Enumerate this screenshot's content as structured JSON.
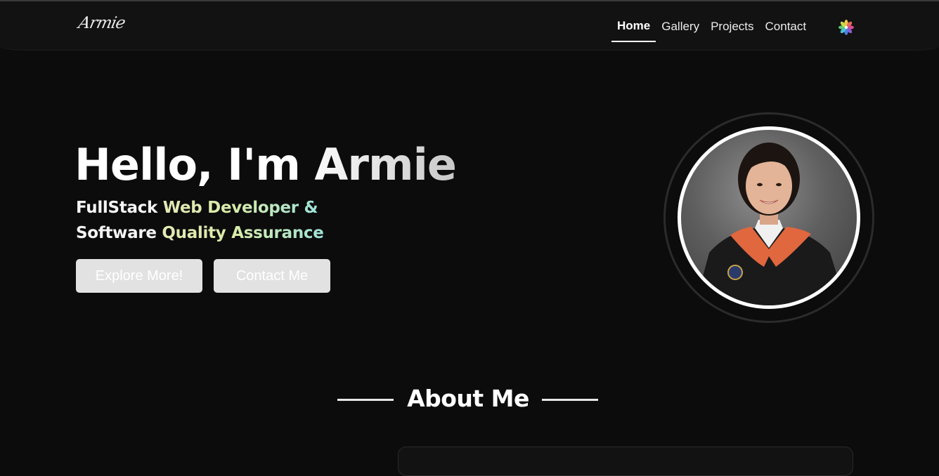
{
  "header": {
    "logo_text": "Armie",
    "nav": [
      {
        "label": "Home",
        "active": true
      },
      {
        "label": "Gallery",
        "active": false
      },
      {
        "label": "Projects",
        "active": false
      },
      {
        "label": "Contact",
        "active": false
      }
    ],
    "theme_icon": "flower-icon"
  },
  "hero": {
    "title": "Hello, I'm Armie",
    "subtitle_line1": {
      "plain": "FullStack ",
      "highlight": "Web Developer &"
    },
    "subtitle_line2": {
      "plain": "Software ",
      "highlight": "Quality Assurance"
    },
    "buttons": {
      "explore_label": "Explore More!",
      "contact_label": "Contact Me"
    },
    "photo": "graduation-portrait"
  },
  "about": {
    "heading": "About Me"
  },
  "colors": {
    "background": "#0c0c0c",
    "navbar": "#121212",
    "button": "#e2e2e2",
    "highlight_start": "#e6e8b4",
    "highlight_end": "#9ee3d8"
  }
}
